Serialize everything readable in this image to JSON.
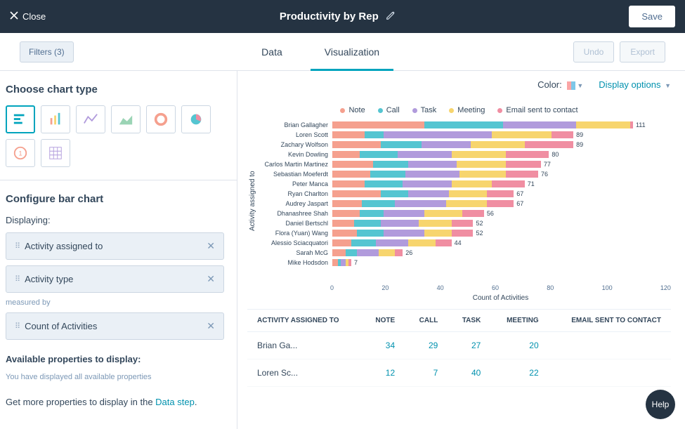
{
  "topbar": {
    "close": "Close",
    "title": "Productivity by Rep",
    "save": "Save"
  },
  "tabrow": {
    "filters": "Filters (3)",
    "data": "Data",
    "visualization": "Visualization",
    "undo": "Undo",
    "export": "Export"
  },
  "left": {
    "choose_title": "Choose chart type",
    "configure_title": "Configure bar chart",
    "displaying_label": "Displaying:",
    "pills": {
      "p0": "Activity assigned to",
      "p1": "Activity type"
    },
    "measured_by": "measured by",
    "pill_measure": "Count of Activities",
    "avail_title": "Available properties to display:",
    "avail_sub": "You have displayed all available properties",
    "getmore_a": "Get more properties to display in the ",
    "getmore_link": "Data step",
    "getmore_b": "."
  },
  "right": {
    "color_label": "Color:",
    "display_options": "Display options",
    "legend": {
      "note": "Note",
      "call": "Call",
      "task": "Task",
      "meeting": "Meeting",
      "email": "Email sent to contact"
    },
    "ylabel": "Activity assigned to",
    "xlabel": "Count of Activities",
    "xticks": {
      "t0": "0",
      "t20": "20",
      "t40": "40",
      "t60": "60",
      "t80": "80",
      "t100": "100",
      "t120": "120"
    }
  },
  "colors": {
    "note": "#f5a08e",
    "call": "#55c5d1",
    "task": "#b19bdc",
    "meeting": "#f7d56e",
    "email": "#f08ea2"
  },
  "chart_data": {
    "type": "bar",
    "orientation": "horizontal",
    "stacked": true,
    "xlabel": "Count of Activities",
    "ylabel": "Activity assigned to",
    "xlim": [
      0,
      125
    ],
    "categories": [
      "Brian Gallagher",
      "Loren Scott",
      "Zachary Wolfson",
      "Kevin Dowling",
      "Carlos Martin Martinez",
      "Sebastian Moeferdt",
      "Peter Manca",
      "Ryan Charlton",
      "Audrey Jaspart",
      "Dhanashree Shah",
      "Daniel Bertschl",
      "Flora (Yuan) Wang",
      "Alessio Sciacquatori",
      "Sarah McG",
      "Mike Hodsdon"
    ],
    "totals": [
      111,
      89,
      89,
      80,
      77,
      76,
      71,
      67,
      67,
      56,
      52,
      52,
      44,
      26,
      7
    ],
    "series": [
      {
        "name": "Note",
        "color": "#f5a08e",
        "values": [
          34,
          12,
          18,
          10,
          15,
          14,
          12,
          18,
          11,
          10,
          8,
          9,
          7,
          5,
          2
        ]
      },
      {
        "name": "Call",
        "color": "#55c5d1",
        "values": [
          29,
          7,
          15,
          14,
          13,
          13,
          14,
          10,
          12,
          9,
          10,
          10,
          9,
          4,
          1
        ]
      },
      {
        "name": "Task",
        "color": "#b19bdc",
        "values": [
          27,
          40,
          18,
          20,
          18,
          20,
          18,
          15,
          19,
          15,
          14,
          15,
          12,
          8,
          2
        ]
      },
      {
        "name": "Meeting",
        "color": "#f7d56e",
        "values": [
          20,
          22,
          20,
          20,
          18,
          17,
          15,
          14,
          15,
          14,
          12,
          10,
          10,
          6,
          1
        ]
      },
      {
        "name": "Email sent to contact",
        "color": "#f08ea2",
        "values": [
          1,
          8,
          18,
          16,
          13,
          12,
          12,
          10,
          10,
          8,
          8,
          8,
          6,
          3,
          1
        ]
      }
    ]
  },
  "table": {
    "headers": {
      "h0": "ACTIVITY ASSIGNED TO",
      "h1": "NOTE",
      "h2": "CALL",
      "h3": "TASK",
      "h4": "MEETING",
      "h5": "EMAIL SENT TO CONTACT"
    },
    "rows": [
      {
        "name": "Brian Ga...",
        "note": "34",
        "call": "29",
        "task": "27",
        "meeting": "20",
        "email": ""
      },
      {
        "name": "Loren Sc...",
        "note": "12",
        "call": "7",
        "task": "40",
        "meeting": "22",
        "email": ""
      }
    ]
  },
  "help": "Help"
}
